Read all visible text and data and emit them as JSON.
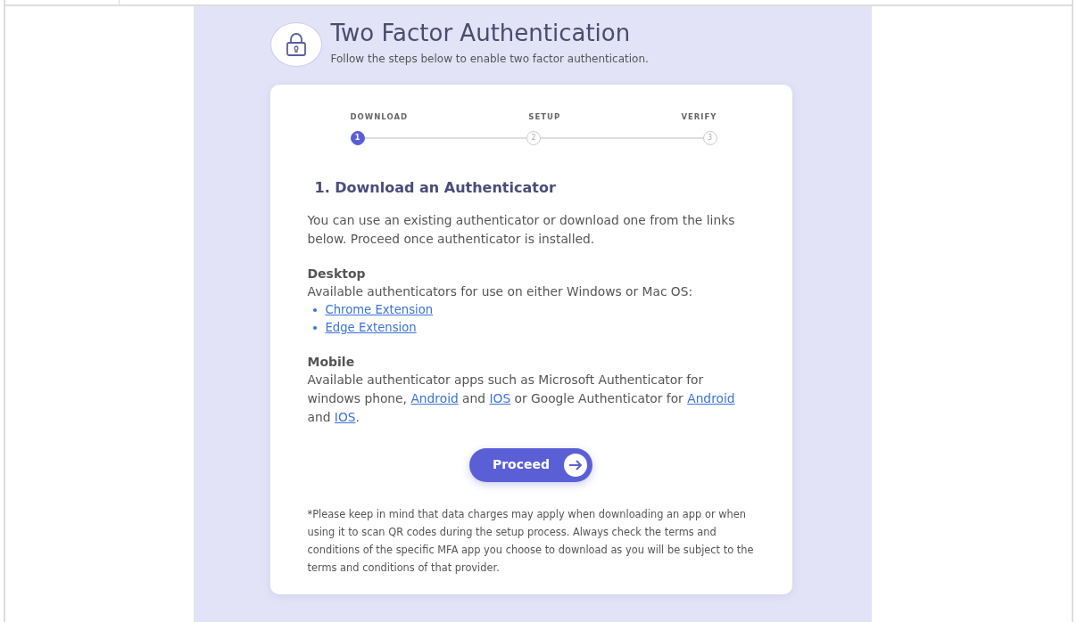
{
  "header": {
    "title": "Two Factor Authentication",
    "subtitle": "Follow the steps below to enable two factor authentication."
  },
  "steps": [
    {
      "label": "DOWNLOAD",
      "number": "1",
      "selected": true
    },
    {
      "label": "SETUP",
      "number": "2",
      "selected": false
    },
    {
      "label": "VERIFY",
      "number": "3",
      "selected": false
    }
  ],
  "heading": "1. Download an Authenticator",
  "intro": "You can use an existing authenticator or download one from the links below. Proceed once authenticator is installed.",
  "desktop": {
    "title": "Desktop",
    "text": "Available authenticators for use on either Windows or Mac OS:",
    "links": [
      "Chrome Extension",
      "Edge Extension"
    ]
  },
  "mobile": {
    "title": "Mobile",
    "parts": [
      {
        "kind": "text",
        "text": "Available authenticator apps such as Microsoft Authenticator for windows phone, "
      },
      {
        "kind": "link",
        "text": "Android"
      },
      {
        "kind": "text",
        "text": " and "
      },
      {
        "kind": "link",
        "text": "IOS"
      },
      {
        "kind": "text",
        "text": " or Google Authenticator for "
      },
      {
        "kind": "link",
        "text": "Android"
      },
      {
        "kind": "text",
        "text": " and "
      },
      {
        "kind": "link",
        "text": "IOS"
      },
      {
        "kind": "text",
        "text": "."
      }
    ]
  },
  "button": "Proceed",
  "footnote": "*Please keep in mind that data charges may apply when downloading an app or when using it to scan QR codes during the setup process. Always check the terms and conditions of the specific MFA app you choose to download as you will be subject to the terms and conditions of that provider."
}
